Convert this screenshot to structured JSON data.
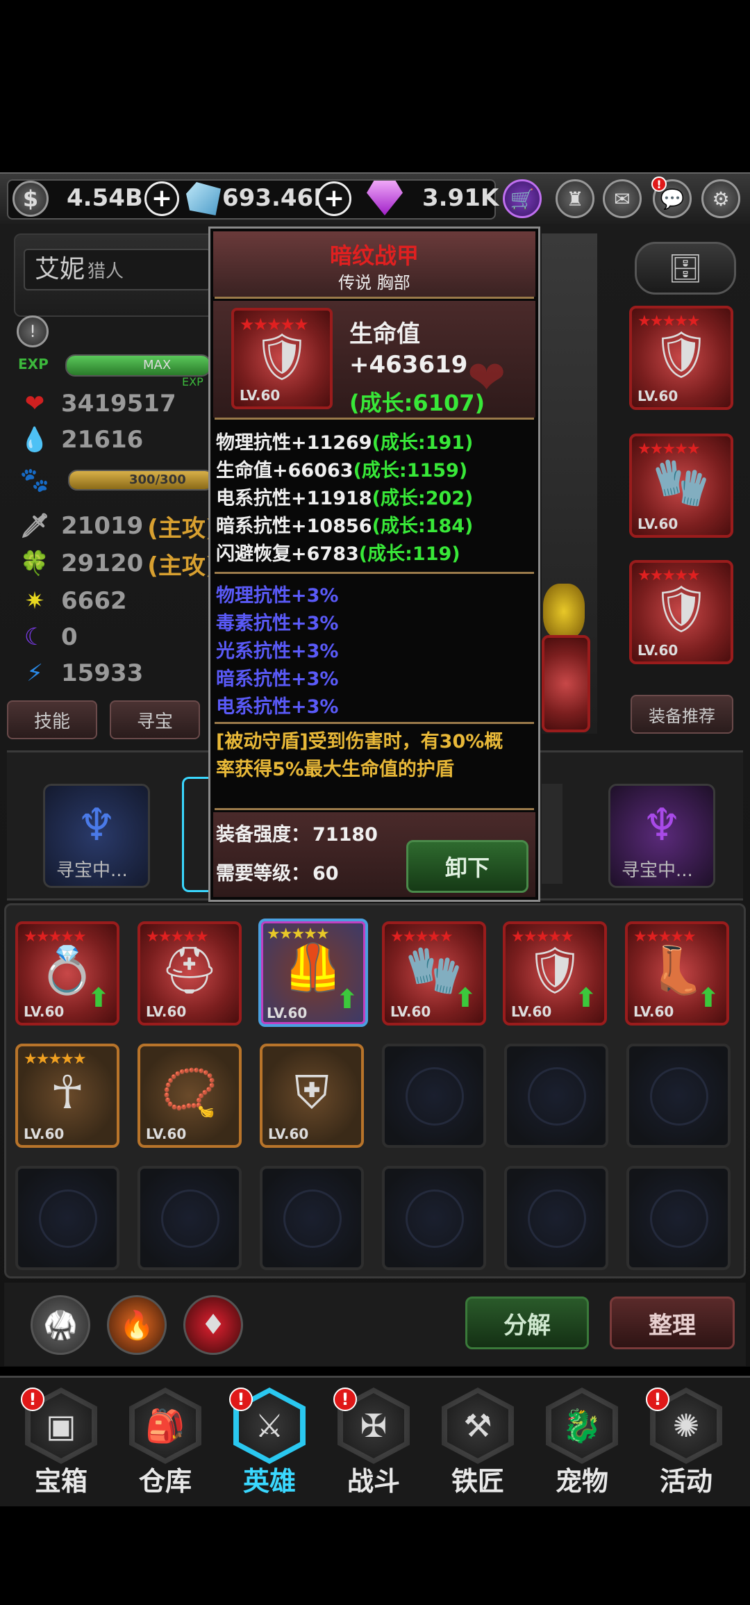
{
  "topbar": {
    "gold": "4.54B",
    "crystal": "693.46M",
    "gem": "3.91K"
  },
  "hero": {
    "name": "艾妮",
    "class": "猎人",
    "exp_label": "EXP",
    "exp_bar_text": "MAX",
    "exp_small": "EXP",
    "exp_fraction": 1.0,
    "pet_bar_text": "300/300",
    "pet_fraction": 1.0,
    "stats": [
      {
        "icon": "heart-icon",
        "value": "3419517",
        "suffix": ""
      },
      {
        "icon": "mana-drop-icon",
        "value": "21616",
        "suffix": ""
      },
      {
        "icon": "sword-icon",
        "value": "21019",
        "suffix": "(主攻)"
      },
      {
        "icon": "leaf-icon",
        "value": "29120",
        "suffix": "(主攻)"
      },
      {
        "icon": "sun-icon",
        "value": "6662",
        "suffix": ""
      },
      {
        "icon": "moon-icon",
        "value": "0",
        "suffix": ""
      },
      {
        "icon": "lightning-icon",
        "value": "15933",
        "suffix": ""
      }
    ],
    "skill_button": "技能",
    "treasure_button": "寻宝",
    "recommend_button": "装备推荐"
  },
  "right_slots": [
    {
      "level": "LV.60",
      "icon": "armor-icon"
    },
    {
      "level": "LV.60",
      "icon": "gauntlet-icon"
    },
    {
      "level": "LV.60",
      "icon": "shield-icon"
    }
  ],
  "treasure_row": {
    "left_label": "寻宝中...",
    "right_label": "寻宝中..."
  },
  "tooltip": {
    "title": "暗纹战甲",
    "subtitle": "传说 胸部",
    "item_level": "LV.60",
    "main_stat_name": "生命值",
    "main_stat_value": "+463619",
    "main_stat_growth": "(成长:6107)",
    "sub_stats": [
      {
        "text": "物理抗性+11269",
        "growth": "(成长:191)"
      },
      {
        "text": "生命值+66063",
        "growth": "(成长:1159)"
      },
      {
        "text": "电系抗性+11918",
        "growth": "(成长:202)"
      },
      {
        "text": "暗系抗性+10856",
        "growth": "(成长:184)"
      },
      {
        "text": "闪避恢复+6783",
        "growth": "(成长:119)"
      }
    ],
    "bonus_stats": [
      "物理抗性+3%",
      "毒素抗性+3%",
      "光系抗性+3%",
      "暗系抗性+3%",
      "电系抗性+3%"
    ],
    "passive_line1": "[被动守盾]受到伤害时，有30%概",
    "passive_line2": "率获得5%最大生命值的护盾",
    "strength_label": "装备强度：",
    "strength_value": "71180",
    "required_label": "需要等级：",
    "required_value": "60",
    "unequip_button": "卸下"
  },
  "inventory": {
    "row1": [
      {
        "level": "LV.60",
        "icon": "ring-icon",
        "upgrade": true
      },
      {
        "level": "LV.60",
        "icon": "helmet-icon",
        "upgrade": false
      },
      {
        "level": "LV.60",
        "icon": "armor-icon",
        "upgrade": true
      },
      {
        "level": "LV.60",
        "icon": "gauntlet-icon",
        "upgrade": true
      },
      {
        "level": "LV.60",
        "icon": "shield-icon",
        "upgrade": true
      },
      {
        "level": "LV.60",
        "icon": "boots-icon",
        "upgrade": true
      }
    ],
    "row2": [
      {
        "level": "LV.60",
        "icon": "amulet-icon"
      },
      {
        "level": "LV.60",
        "icon": "necklace-icon"
      },
      {
        "level": "LV.60",
        "icon": "round-shield-icon"
      }
    ],
    "decompose_button": "分解",
    "sort_button": "整理"
  },
  "nav": [
    {
      "label": "宝箱",
      "icon": "chest-icon",
      "alert": true
    },
    {
      "label": "仓库",
      "icon": "backpack-icon",
      "alert": false
    },
    {
      "label": "英雄",
      "icon": "hero-sword-icon",
      "alert": true,
      "active": true
    },
    {
      "label": "战斗",
      "icon": "battle-icon",
      "alert": true
    },
    {
      "label": "铁匠",
      "icon": "anvil-icon",
      "alert": false
    },
    {
      "label": "宠物",
      "icon": "pet-icon",
      "alert": false
    },
    {
      "label": "活动",
      "icon": "event-icon",
      "alert": true
    }
  ],
  "colors": {
    "legendary_red": "#e02020",
    "growth_green": "#38e838",
    "bonus_blue": "#5a5af8",
    "passive_gold": "#e8b838",
    "active_cyan": "#3ad8ff"
  }
}
